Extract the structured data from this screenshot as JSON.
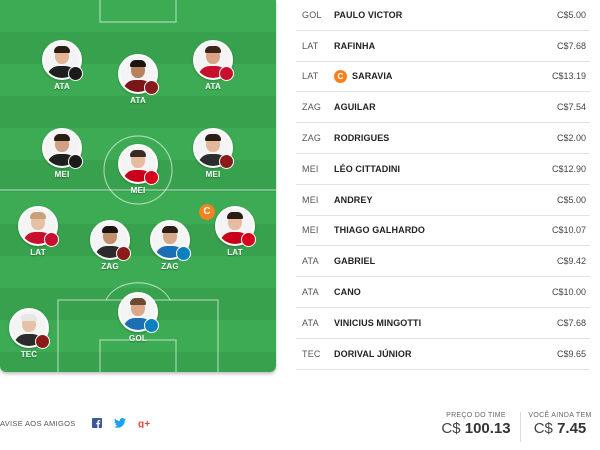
{
  "field": {
    "players": [
      {
        "pos": "ATA",
        "badge": "#1a1a1a",
        "skin": "#e3b596",
        "hair": "#2a1d16",
        "shirt": "#1f1f1f"
      },
      {
        "pos": "ATA",
        "badge": "#8b1a1a",
        "skin": "#b7835f",
        "hair": "#1c1411",
        "shirt": "#7a1616"
      },
      {
        "pos": "ATA",
        "badge": "#c8102e",
        "skin": "#d9a486",
        "hair": "#3b2418",
        "shirt": "#c8102e"
      },
      {
        "pos": "MEI",
        "badge": "#1a1a1a",
        "skin": "#d1a184",
        "hair": "#2a1d16",
        "shirt": "#1f1f1f"
      },
      {
        "pos": "MEI",
        "badge": "#d6001c",
        "skin": "#e6bca0",
        "hair": "#3a2a1f",
        "shirt": "#c9001a"
      },
      {
        "pos": "MEI",
        "badge": "#8b1a1a",
        "skin": "#e2b89c",
        "hair": "#2a1d16",
        "shirt": "#2d2d2d"
      },
      {
        "pos": "LAT",
        "badge": "#c8102e",
        "skin": "#e6c0a5",
        "hair": "#c9a078",
        "shirt": "#c8102e"
      },
      {
        "pos": "ZAG",
        "badge": "#8b1a1a",
        "skin": "#c28f6c",
        "hair": "#1c1411",
        "shirt": "#2b2b2b"
      },
      {
        "pos": "ZAG",
        "badge": "#0d80bf",
        "skin": "#d7a98b",
        "hair": "#2a1d16",
        "shirt": "#1d6fb3"
      },
      {
        "pos": "LAT",
        "badge": "#d6001c",
        "skin": "#e6bca0",
        "hair": "#2a1d16",
        "shirt": "#c9001a"
      },
      {
        "pos": "GOL",
        "badge": "#0d80bf",
        "skin": "#dba98a",
        "hair": "#6b4a32",
        "shirt": "#1d6fb3"
      },
      {
        "pos": "TEC",
        "badge": "#8b1a1a",
        "skin": "#e8c2a8",
        "hair": "#e6e6e6",
        "shirt": "#2b2b2b"
      }
    ],
    "captain_mark": "C"
  },
  "lineup": [
    {
      "pos": "GOL",
      "name": "PAULO VICTOR",
      "price": "C$5.00",
      "captain": false
    },
    {
      "pos": "LAT",
      "name": "RAFINHA",
      "price": "C$7.68",
      "captain": false
    },
    {
      "pos": "LAT",
      "name": "SARAVIA",
      "price": "C$13.19",
      "captain": true
    },
    {
      "pos": "ZAG",
      "name": "AGUILAR",
      "price": "C$7.54",
      "captain": false
    },
    {
      "pos": "ZAG",
      "name": "RODRIGUES",
      "price": "C$2.00",
      "captain": false
    },
    {
      "pos": "MEI",
      "name": "LÉO CITTADINI",
      "price": "C$12.90",
      "captain": false
    },
    {
      "pos": "MEI",
      "name": "ANDREY",
      "price": "C$5.00",
      "captain": false
    },
    {
      "pos": "MEI",
      "name": "THIAGO GALHARDO",
      "price": "C$10.07",
      "captain": false
    },
    {
      "pos": "ATA",
      "name": "GABRIEL",
      "price": "C$9.42",
      "captain": false
    },
    {
      "pos": "ATA",
      "name": "CANO",
      "price": "C$10.00",
      "captain": false
    },
    {
      "pos": "ATA",
      "name": "VINICIUS MINGOTTI",
      "price": "C$7.68",
      "captain": false
    },
    {
      "pos": "TEC",
      "name": "DORIVAL JÚNIOR",
      "price": "C$9.65",
      "captain": false
    }
  ],
  "captain_mark": "C",
  "footer": {
    "share_label": "AVISE AOS AMIGOS",
    "team_price_caption": "PREÇO DO TIME",
    "team_price_currency": "C$",
    "team_price_value": "100.13",
    "remaining_caption": "VOCÊ AINDA TEM",
    "remaining_currency": "C$",
    "remaining_value": "7.45"
  },
  "colors": {
    "accent": "#f5821f",
    "pitch": "#3cab53",
    "facebook": "#3b5998",
    "twitter": "#1da1f2",
    "googleplus": "#dd4b39"
  },
  "icons": [
    "facebook-icon",
    "twitter-icon",
    "google-plus-icon",
    "captain-icon"
  ]
}
